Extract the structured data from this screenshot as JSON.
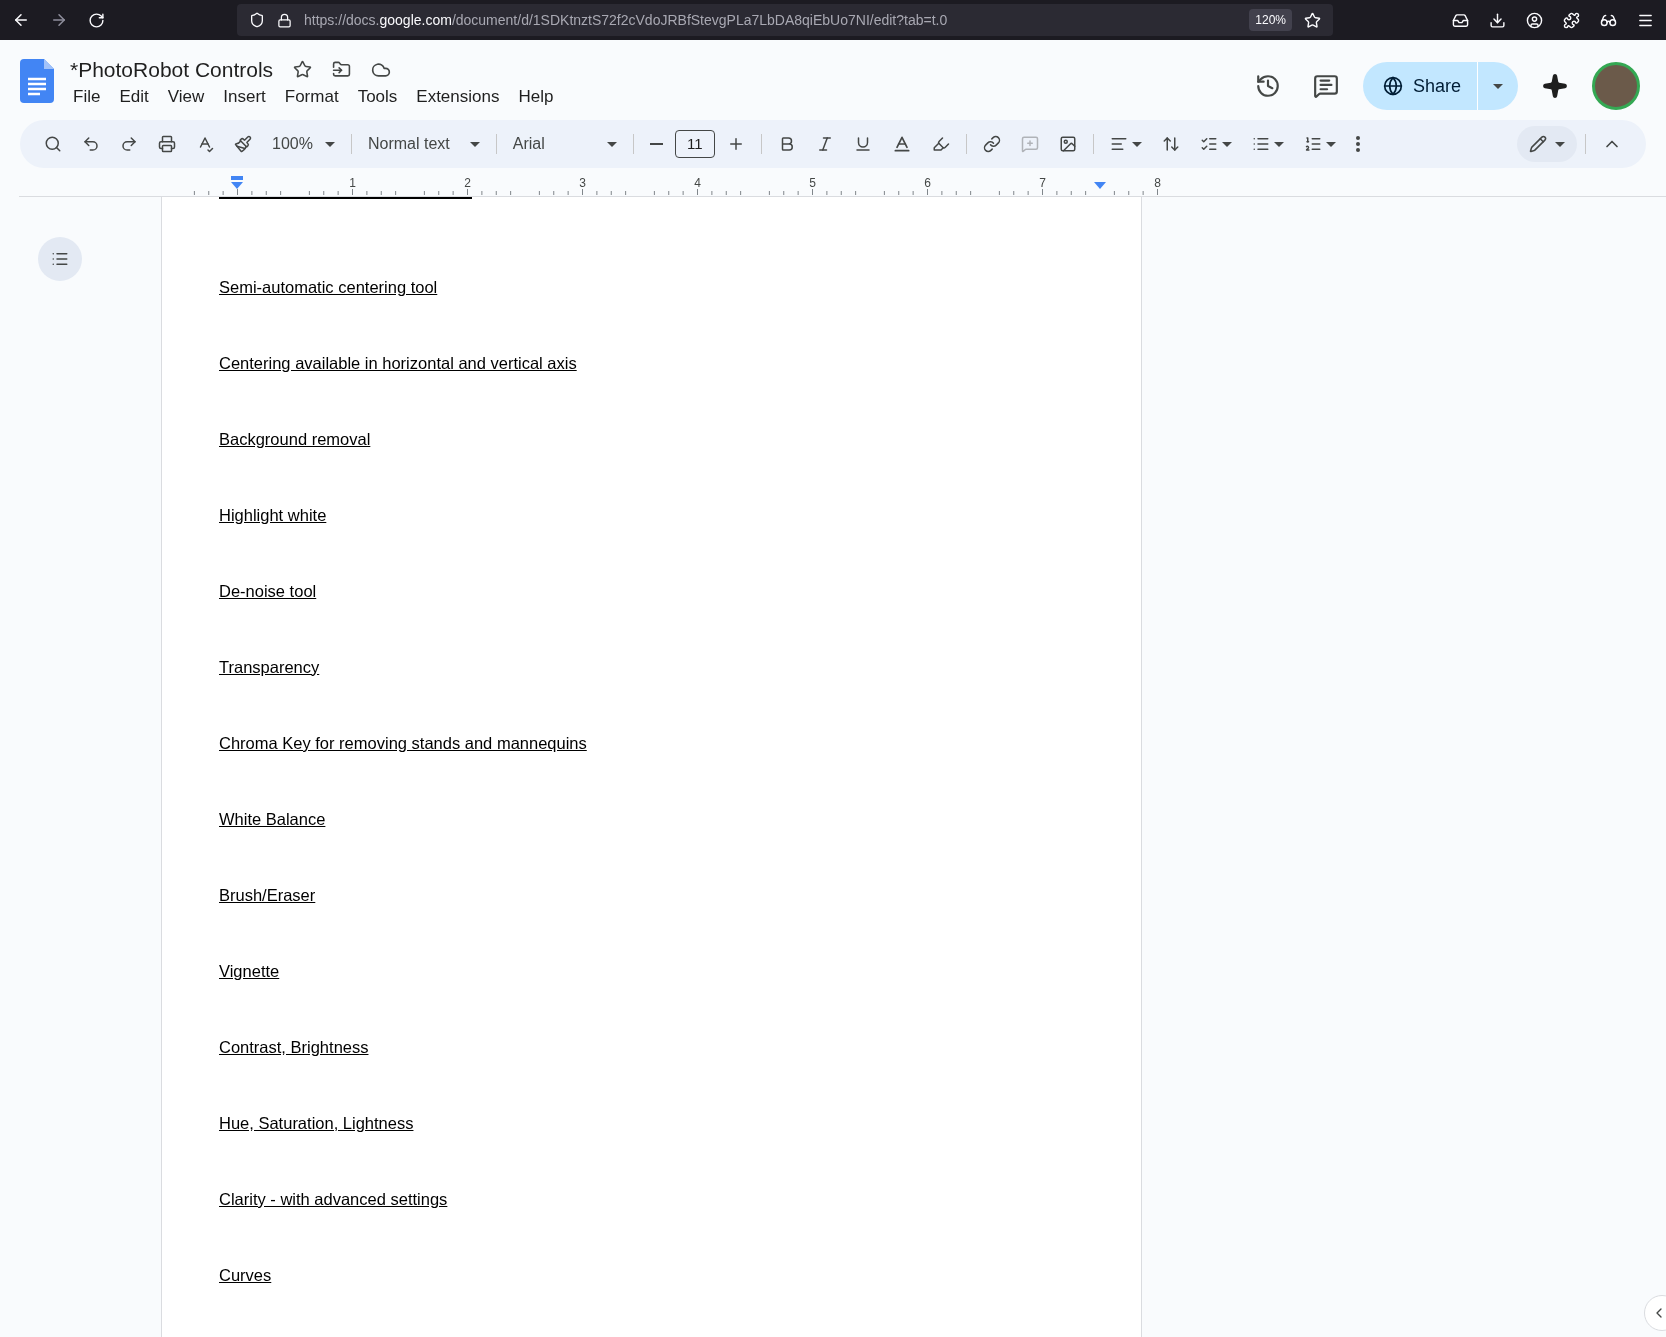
{
  "browser": {
    "url_scheme": "https://docs.",
    "url_domain": "google.com",
    "url_path": "/document/d/1SDKtnztS72f2cVdoJRBfStevgPLa7LbDA8qiEbUo7NI/edit?tab=t.0",
    "zoom": "120%"
  },
  "document": {
    "title": "*PhotoRobot Controls",
    "menu": [
      "File",
      "Edit",
      "View",
      "Insert",
      "Format",
      "Tools",
      "Extensions",
      "Help"
    ]
  },
  "share_button": "Share",
  "toolbar": {
    "zoom": "100%",
    "style": "Normal text",
    "font": "Arial",
    "font_size": "11"
  },
  "ruler": {
    "labels": [
      "1",
      "2",
      "3",
      "4",
      "5",
      "6",
      "7",
      "8"
    ]
  },
  "page": {
    "lines": [
      "Semi-automatic centering tool",
      "Centering available in horizontal and vertical axis",
      "Background removal",
      "Highlight white",
      "De-noise tool",
      "Transparency",
      "Chroma Key for removing stands and mannequins",
      "White Balance",
      "Brush/Eraser",
      "Vignette",
      "Contrast, Brightness",
      "Hue, Saturation, Lightness",
      "Clarity - with advanced settings",
      "Curves"
    ]
  }
}
